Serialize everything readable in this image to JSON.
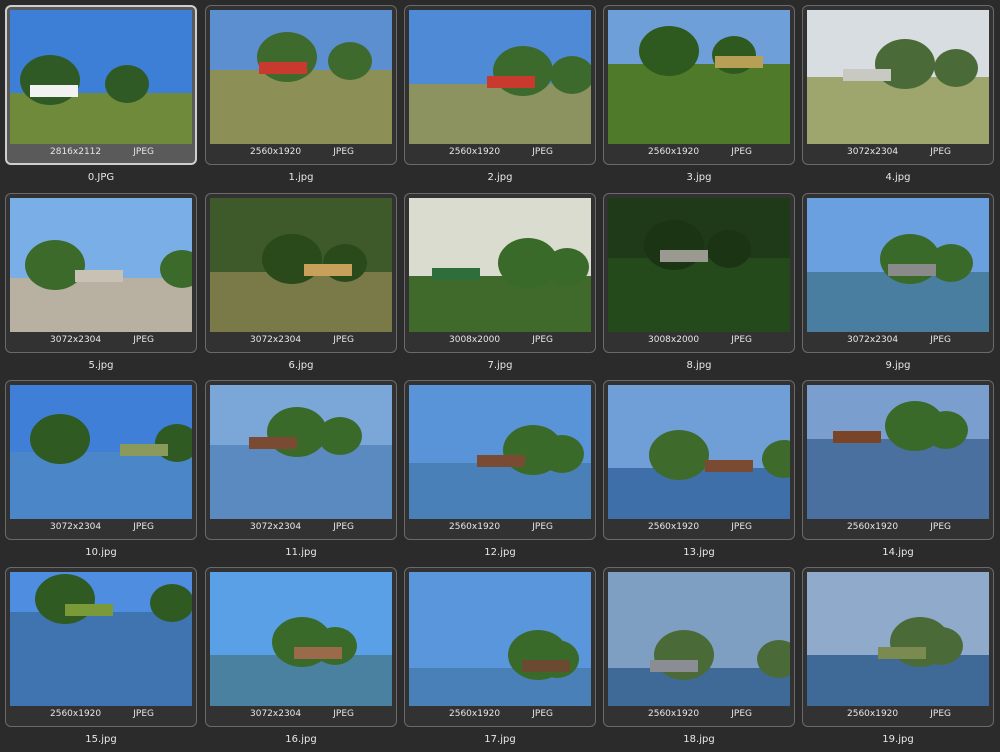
{
  "gallery": {
    "items": [
      {
        "filename": "0.JPG",
        "dims": "2816x2112",
        "format": "JPEG",
        "selected": true,
        "scene": {
          "sky": "#3d7fd6",
          "land": "#6f8a3a",
          "horizon": 0.62,
          "accent": "#f2f2f2",
          "trees": "#2f5a25"
        }
      },
      {
        "filename": "1.jpg",
        "dims": "2560x1920",
        "format": "JPEG",
        "selected": false,
        "scene": {
          "sky": "#5b8fd0",
          "land": "#8c8f56",
          "horizon": 0.45,
          "accent": "#c93a2e",
          "trees": "#3f6a2e"
        }
      },
      {
        "filename": "2.jpg",
        "dims": "2560x1920",
        "format": "JPEG",
        "selected": false,
        "scene": {
          "sky": "#4f8ad6",
          "land": "#8d9360",
          "horizon": 0.55,
          "accent": "#c93a2e",
          "trees": "#3c6a2c"
        }
      },
      {
        "filename": "3.jpg",
        "dims": "2560x1920",
        "format": "JPEG",
        "selected": false,
        "scene": {
          "sky": "#6f9fd8",
          "land": "#4f7a2a",
          "horizon": 0.4,
          "accent": "#b7a055",
          "trees": "#2e5a20"
        }
      },
      {
        "filename": "4.jpg",
        "dims": "3072x2304",
        "format": "JPEG",
        "selected": false,
        "scene": {
          "sky": "#d8dde2",
          "land": "#9ea56d",
          "horizon": 0.5,
          "accent": "#c7c9c2",
          "trees": "#4a6a38"
        }
      },
      {
        "filename": "5.jpg",
        "dims": "3072x2304",
        "format": "JPEG",
        "selected": false,
        "scene": {
          "sky": "#7aaee6",
          "land": "#b8b0a0",
          "horizon": 0.6,
          "accent": "#c8c2b4",
          "trees": "#3b6a2a"
        }
      },
      {
        "filename": "6.jpg",
        "dims": "3072x2304",
        "format": "JPEG",
        "selected": false,
        "scene": {
          "sky": "#3e5a2a",
          "land": "#7a7a48",
          "horizon": 0.55,
          "accent": "#c9a05a",
          "trees": "#2a4a1c"
        }
      },
      {
        "filename": "7.jpg",
        "dims": "3008x2000",
        "format": "JPEG",
        "selected": false,
        "scene": {
          "sky": "#d9dccf",
          "land": "#3f6a2c",
          "horizon": 0.58,
          "accent": "#2f6e3a",
          "trees": "#3a6a2a"
        }
      },
      {
        "filename": "8.jpg",
        "dims": "3008x2000",
        "format": "JPEG",
        "selected": false,
        "scene": {
          "sky": "#1f3a18",
          "land": "#244a1c",
          "horizon": 0.45,
          "accent": "#9a9a90",
          "trees": "#1a3414"
        }
      },
      {
        "filename": "9.jpg",
        "dims": "3072x2304",
        "format": "JPEG",
        "selected": false,
        "scene": {
          "sky": "#6aa0e0",
          "land": "#4a7ea0",
          "horizon": 0.55,
          "accent": "#8a8a8a",
          "trees": "#3a6a2a"
        }
      },
      {
        "filename": "10.jpg",
        "dims": "3072x2304",
        "format": "JPEG",
        "selected": false,
        "scene": {
          "sky": "#3f7fd8",
          "land": "#4a86c8",
          "horizon": 0.5,
          "accent": "#8a9a5a",
          "trees": "#2f5a22"
        }
      },
      {
        "filename": "11.jpg",
        "dims": "3072x2304",
        "format": "JPEG",
        "selected": false,
        "scene": {
          "sky": "#7aa6d8",
          "land": "#5a8ac0",
          "horizon": 0.45,
          "accent": "#7a4a32",
          "trees": "#3a6a2a"
        }
      },
      {
        "filename": "12.jpg",
        "dims": "2560x1920",
        "format": "JPEG",
        "selected": false,
        "scene": {
          "sky": "#5a94d8",
          "land": "#4a80b8",
          "horizon": 0.58,
          "accent": "#7a4a32",
          "trees": "#3a6a2a"
        }
      },
      {
        "filename": "13.jpg",
        "dims": "2560x1920",
        "format": "JPEG",
        "selected": false,
        "scene": {
          "sky": "#6f9fd6",
          "land": "#3f6fa8",
          "horizon": 0.62,
          "accent": "#7a4a32",
          "trees": "#3e6a2c"
        }
      },
      {
        "filename": "14.jpg",
        "dims": "2560x1920",
        "format": "JPEG",
        "selected": false,
        "scene": {
          "sky": "#7a9fcf",
          "land": "#4a70a0",
          "horizon": 0.4,
          "accent": "#7a4428",
          "trees": "#3a6a2a"
        }
      },
      {
        "filename": "15.jpg",
        "dims": "2560x1920",
        "format": "JPEG",
        "selected": false,
        "scene": {
          "sky": "#4f8de0",
          "land": "#3f74b0",
          "horizon": 0.3,
          "accent": "#7a9a3a",
          "trees": "#2f5a22"
        }
      },
      {
        "filename": "16.jpg",
        "dims": "3072x2304",
        "format": "JPEG",
        "selected": false,
        "scene": {
          "sky": "#5aa0e6",
          "land": "#4a80a0",
          "horizon": 0.62,
          "accent": "#9a6a4a",
          "trees": "#3a6a2a"
        }
      },
      {
        "filename": "17.jpg",
        "dims": "2560x1920",
        "format": "JPEG",
        "selected": false,
        "scene": {
          "sky": "#5a96dc",
          "land": "#4a80b8",
          "horizon": 0.72,
          "accent": "#6a4a30",
          "trees": "#3a6a2a"
        }
      },
      {
        "filename": "18.jpg",
        "dims": "2560x1920",
        "format": "JPEG",
        "selected": false,
        "scene": {
          "sky": "#7f9fc2",
          "land": "#3f6a98",
          "horizon": 0.72,
          "accent": "#8a8e94",
          "trees": "#4a6a38"
        }
      },
      {
        "filename": "19.jpg",
        "dims": "2560x1920",
        "format": "JPEG",
        "selected": false,
        "scene": {
          "sky": "#8faacb",
          "land": "#3f6a98",
          "horizon": 0.62,
          "accent": "#7a8a50",
          "trees": "#4a6a38"
        }
      }
    ]
  }
}
